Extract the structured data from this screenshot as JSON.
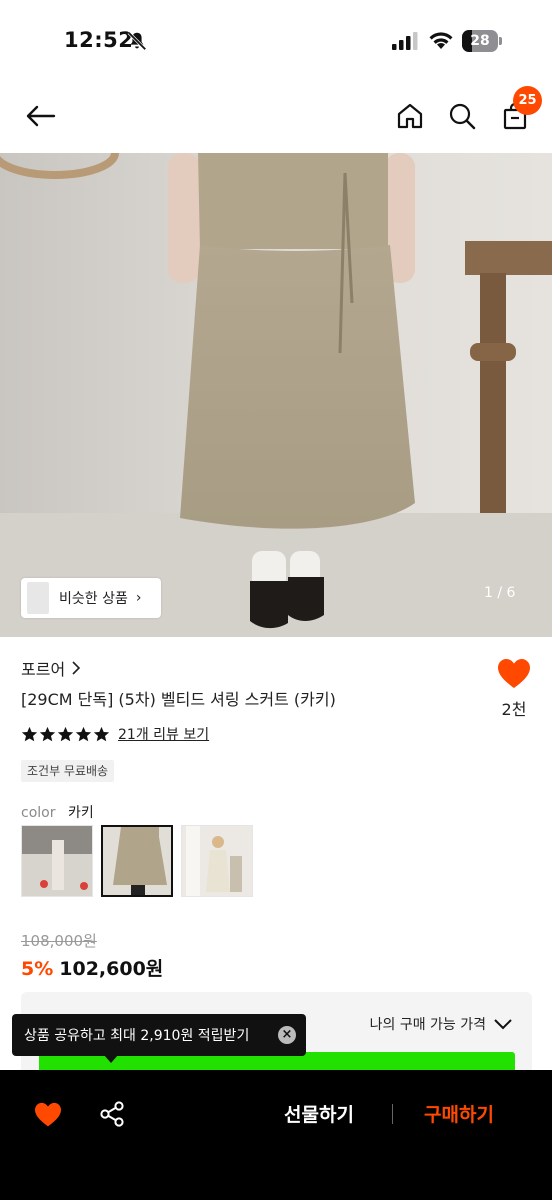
{
  "status_bar": {
    "time": "12:52",
    "battery": "28"
  },
  "nav": {
    "cart_count": "25"
  },
  "gallery": {
    "similar_label": "비슷한 상품",
    "counter": "1 / 6"
  },
  "product": {
    "brand": "포르어",
    "title": "[29CM 단독] (5차) 벨티드 셔링 스커트 (카키)",
    "likes": "2천",
    "review_link": "21개 리뷰 보기",
    "rating_stars": 5,
    "shipping_badge": "조건부 무료배송",
    "color_key": "color",
    "color_value": "카키",
    "original_price": "108,000원",
    "discount": "5%",
    "price": "102,600원",
    "my_price_label": "나의 구매 가능 가격"
  },
  "tooltip": {
    "text": "상품 공유하고 최대 2,910원 적립받기"
  },
  "bottom_bar": {
    "gift_label": "선물하기",
    "buy_label": "구매하기"
  },
  "colors": {
    "accent": "#ff4800",
    "promo_green": "#22e000",
    "bottom_bar": "#000000"
  }
}
